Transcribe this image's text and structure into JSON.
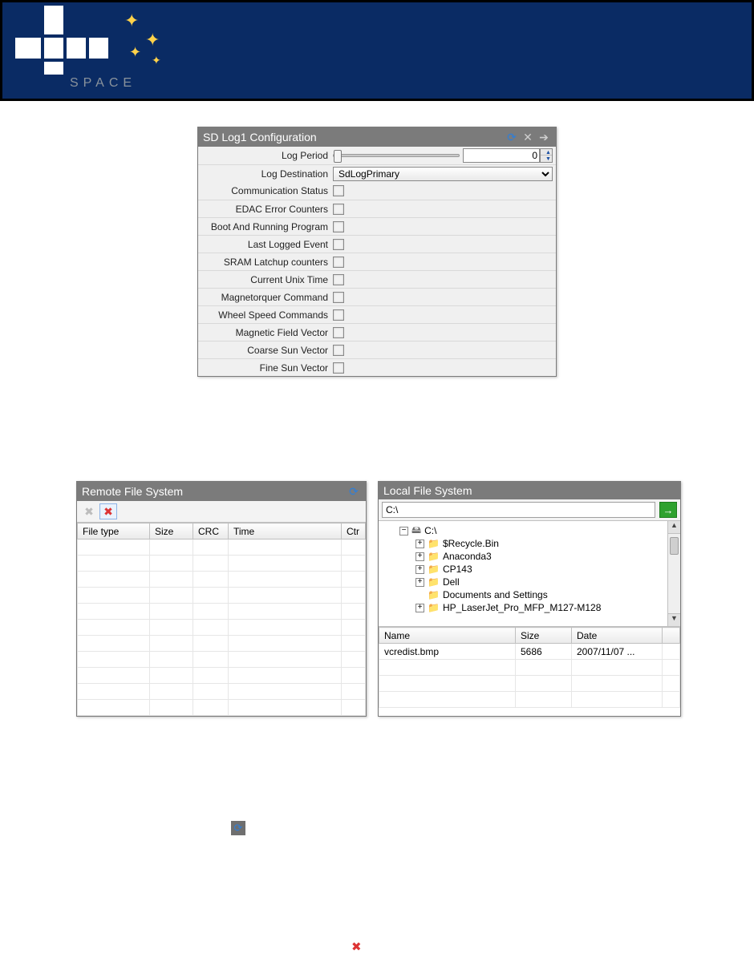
{
  "logo": {
    "space": "SPACE"
  },
  "sdlog": {
    "title": "SD Log1 Configuration",
    "period_label": "Log Period",
    "period_value": "0",
    "destination_label": "Log Destination",
    "destination_value": "SdLogPrimary",
    "checks": [
      "Communication Status",
      "EDAC Error Counters",
      "Boot And Running Program",
      "Last Logged Event",
      "SRAM Latchup counters",
      "Current Unix Time",
      "Magnetorquer Command",
      "Wheel Speed Commands",
      "Magnetic Field Vector",
      "Coarse Sun Vector",
      "Fine Sun Vector"
    ]
  },
  "remote_fs": {
    "title": "Remote File System",
    "cols": [
      "File type",
      "Size",
      "CRC",
      "Time",
      "Ctr"
    ]
  },
  "local_fs": {
    "title": "Local File System",
    "path": "C:\\",
    "root": "C:\\",
    "folders": [
      "$Recycle.Bin",
      "Anaconda3",
      "CP143",
      "Dell",
      "Documents and Settings",
      "HP_LaserJet_Pro_MFP_M127-M128"
    ],
    "files_cols": [
      "Name",
      "Size",
      "Date"
    ],
    "files": [
      {
        "name": "vcredist.bmp",
        "size": "5686",
        "date": "2007/11/07 ..."
      }
    ]
  }
}
